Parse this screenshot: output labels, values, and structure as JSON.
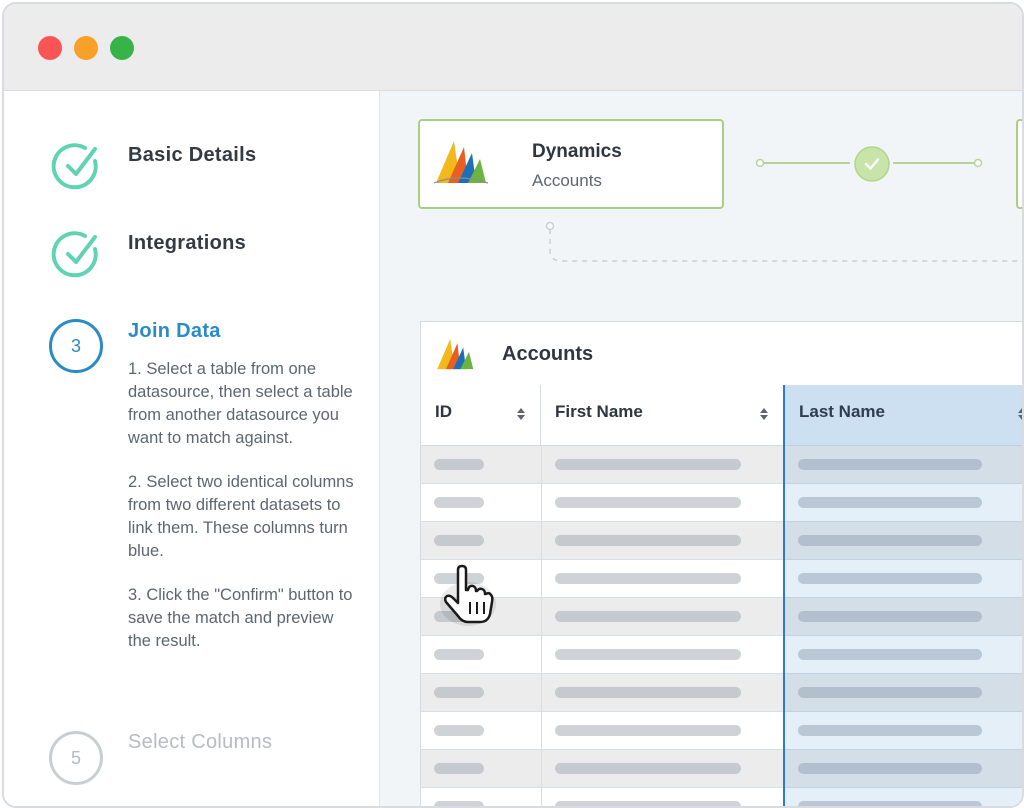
{
  "steps": [
    {
      "title": "Basic Details",
      "state": "done",
      "icon": "check-circle-icon"
    },
    {
      "title": "Integrations",
      "state": "done",
      "icon": "check-circle-icon"
    },
    {
      "number": "3",
      "title": "Join Data",
      "state": "active",
      "desc": [
        "1. Select a table from one datasource, then select a table from another datasource you want to match against.",
        "2. Select two identical columns from two different datasets to link them. These columns turn blue.",
        "3. Click the \"Confirm\" button to save the match and preview the result."
      ]
    },
    {
      "number": "5",
      "title": "Select Columns",
      "state": "pending"
    }
  ],
  "source": {
    "name": "Dynamics",
    "table": "Accounts",
    "logo": "dynamics-logo"
  },
  "table": {
    "title": "Accounts",
    "columns": [
      {
        "label": "ID"
      },
      {
        "label": "First Name"
      },
      {
        "label": "Last Name",
        "selected": true
      }
    ],
    "row_count": 10
  },
  "colors": {
    "accent": "#2a8bc6",
    "success": "#5fd3b2",
    "card_border": "#a9cf86",
    "selected_column": "#2b7cc6"
  }
}
